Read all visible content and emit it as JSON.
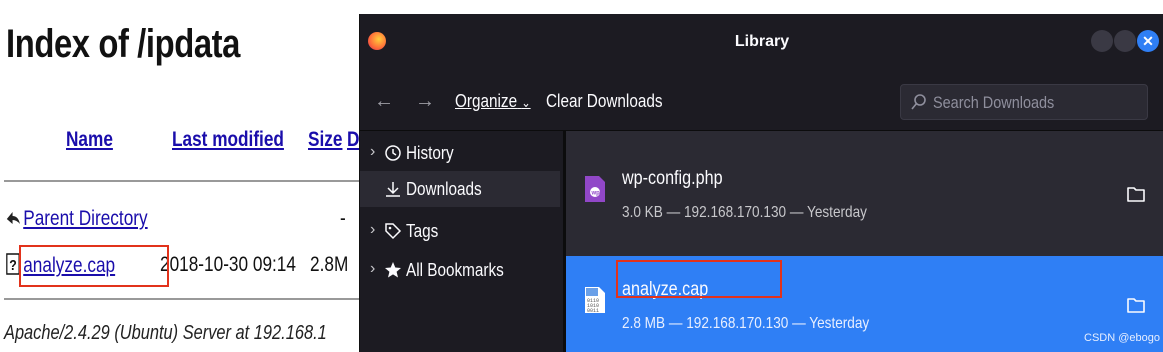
{
  "index": {
    "title": "Index of /ipdata",
    "columns": {
      "name": "Name",
      "last_modified": "Last modified",
      "size": "Size",
      "desc": "D"
    },
    "rows": [
      {
        "name": "Parent Directory",
        "modified": "",
        "size": "-"
      },
      {
        "name": "analyze.cap",
        "modified": "2018-10-30 09:14",
        "size": "2.8M"
      }
    ],
    "footer": "Apache/2.4.29 (Ubuntu) Server at 192.168.1"
  },
  "library": {
    "title": "Library",
    "toolbar": {
      "organize": "Organize",
      "clear_downloads": "Clear Downloads",
      "search_placeholder": "Search Downloads"
    },
    "sidebar": [
      {
        "label": "History",
        "icon": "clock-icon",
        "expandable": true
      },
      {
        "label": "Downloads",
        "icon": "download-icon",
        "expandable": false,
        "selected": true
      },
      {
        "label": "Tags",
        "icon": "tag-icon",
        "expandable": true
      },
      {
        "label": "All Bookmarks",
        "icon": "star-icon",
        "expandable": true
      }
    ],
    "downloads": [
      {
        "name": "wp-config.php",
        "status": "3.0 KB — 192.168.170.130 — Yesterday",
        "icon": "php-file-icon"
      },
      {
        "name": "analyze.cap",
        "status": "2.8 MB — 192.168.170.130 — Yesterday",
        "icon": "binary-file-icon",
        "selected": true
      }
    ],
    "colors": {
      "accent": "#2f7ff5",
      "window_bg": "#2b2a33",
      "chrome_bg": "#1c1b22",
      "highlight_box": "#e2321b"
    }
  },
  "watermark": "CSDN @ebogo"
}
